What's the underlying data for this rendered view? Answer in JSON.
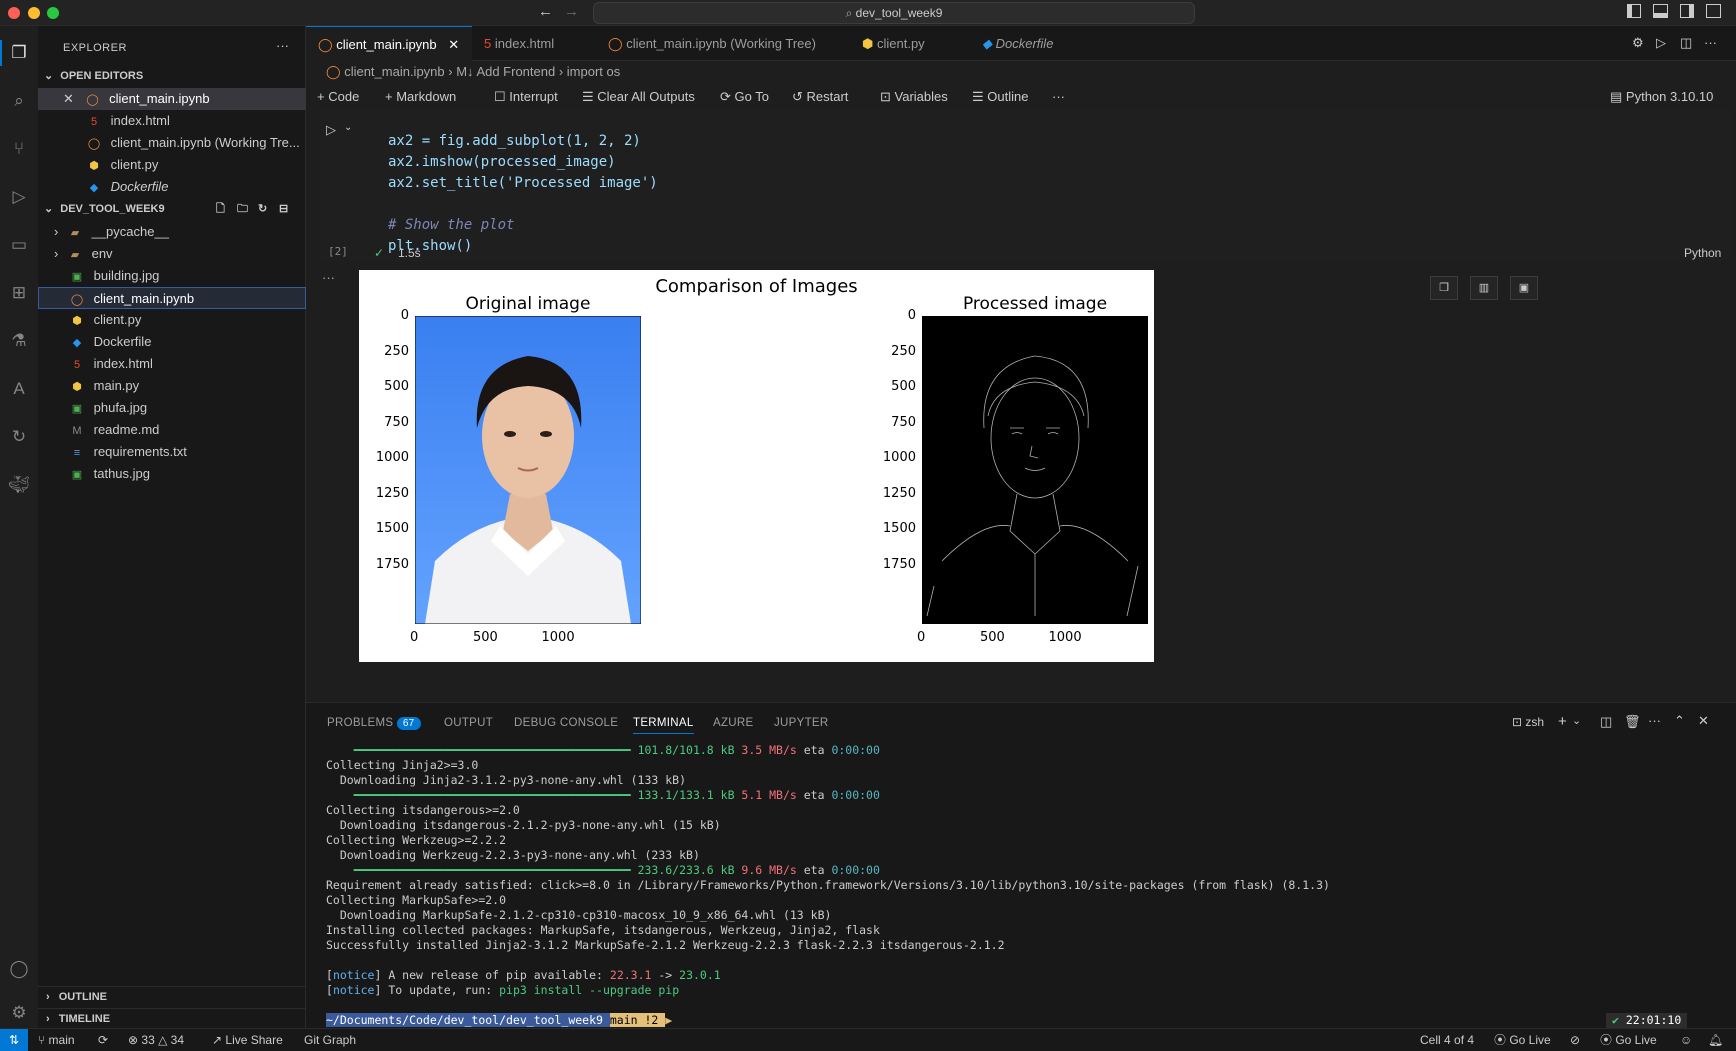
{
  "window": {
    "title": "dev_tool_week9"
  },
  "explorer": {
    "title": "EXPLORER",
    "open_editors_label": "OPEN EDITORS",
    "open_editors": [
      {
        "name": "client_main.ipynb",
        "icon": "notebook-icon"
      },
      {
        "name": "index.html",
        "icon": "html-icon"
      },
      {
        "name": "client_main.ipynb (Working Tre...",
        "icon": "notebook-icon"
      },
      {
        "name": "client.py",
        "icon": "python-icon"
      },
      {
        "name": "Dockerfile",
        "icon": "docker-icon"
      }
    ],
    "folder_label": "DEV_TOOL_WEEK9",
    "files": [
      {
        "name": "__pycache__",
        "icon": "folder-icon"
      },
      {
        "name": "env",
        "icon": "folder-icon"
      },
      {
        "name": "building.jpg",
        "icon": "image-icon"
      },
      {
        "name": "client_main.ipynb",
        "icon": "notebook-icon"
      },
      {
        "name": "client.py",
        "icon": "python-icon"
      },
      {
        "name": "Dockerfile",
        "icon": "docker-icon"
      },
      {
        "name": "index.html",
        "icon": "html-icon"
      },
      {
        "name": "main.py",
        "icon": "python-icon"
      },
      {
        "name": "phufa.jpg",
        "icon": "image-icon"
      },
      {
        "name": "readme.md",
        "icon": "markdown-icon"
      },
      {
        "name": "requirements.txt",
        "icon": "text-icon"
      },
      {
        "name": "tathus.jpg",
        "icon": "image-icon"
      }
    ],
    "outline_label": "OUTLINE",
    "timeline_label": "TIMELINE"
  },
  "tabs": [
    {
      "label": "client_main.ipynb"
    },
    {
      "label": "index.html"
    },
    {
      "label": "client_main.ipynb (Working Tree)"
    },
    {
      "label": "client.py"
    },
    {
      "label": "Dockerfile"
    }
  ],
  "breadcrumb": {
    "file": "client_main.ipynb",
    "section": "M↓ Add Frontend",
    "symbol": "import os"
  },
  "notebook_toolbar": {
    "code": "Code",
    "markdown": "Markdown",
    "interrupt": "Interrupt",
    "clear": "Clear All Outputs",
    "goto": "Go To",
    "restart": "Restart",
    "variables": "Variables",
    "outline": "Outline",
    "more": "···",
    "kernel": "Python 3.10.10"
  },
  "cell": {
    "exec_count": "[2]",
    "duration": "1.5s",
    "language": "Python",
    "code": {
      "line1": "ax2 = fig.add_subplot(1, 2, 2)",
      "line2": "ax2.imshow(processed_image)",
      "line3": "ax2.set_title('Processed image')",
      "line5": "# Show the plot",
      "line6": "plt.show()"
    }
  },
  "figure": {
    "title": "Comparison of Images",
    "left_title": "Original image",
    "right_title": "Processed image",
    "y_ticks": [
      "0",
      "250",
      "500",
      "750",
      "1000",
      "1250",
      "1500",
      "1750"
    ],
    "x_ticks": [
      "0",
      "500",
      "1000"
    ]
  },
  "panel": {
    "tabs": [
      "PROBLEMS",
      "OUTPUT",
      "DEBUG CONSOLE",
      "TERMINAL",
      "AZURE",
      "JUPYTER"
    ],
    "problems_count": "67",
    "shell": "zsh"
  },
  "terminal": {
    "lines": [
      {
        "parts": [
          {
            "t": "    ━━━━━━━━━━━━━━━━━━━━━━━━━━━━━━━━━━━━━━━━ ",
            "c": "g"
          },
          {
            "t": "101.8/101.8 kB",
            "c": "g"
          },
          {
            "t": " 3.5 MB/s",
            "c": "r"
          },
          {
            "t": " eta ",
            "c": ""
          },
          {
            "t": "0:00:00",
            "c": "c"
          }
        ]
      },
      {
        "parts": [
          {
            "t": "Collecting Jinja2>=3.0",
            "c": ""
          }
        ]
      },
      {
        "parts": [
          {
            "t": "  Downloading Jinja2-3.1.2-py3-none-any.whl (133 kB)",
            "c": ""
          }
        ]
      },
      {
        "parts": [
          {
            "t": "    ━━━━━━━━━━━━━━━━━━━━━━━━━━━━━━━━━━━━━━━━ ",
            "c": "g"
          },
          {
            "t": "133.1/133.1 kB",
            "c": "g"
          },
          {
            "t": " 5.1 MB/s",
            "c": "r"
          },
          {
            "t": " eta ",
            "c": ""
          },
          {
            "t": "0:00:00",
            "c": "c"
          }
        ]
      },
      {
        "parts": [
          {
            "t": "Collecting itsdangerous>=2.0",
            "c": ""
          }
        ]
      },
      {
        "parts": [
          {
            "t": "  Downloading itsdangerous-2.1.2-py3-none-any.whl (15 kB)",
            "c": ""
          }
        ]
      },
      {
        "parts": [
          {
            "t": "Collecting Werkzeug>=2.2.2",
            "c": ""
          }
        ]
      },
      {
        "parts": [
          {
            "t": "  Downloading Werkzeug-2.2.3-py3-none-any.whl (233 kB)",
            "c": ""
          }
        ]
      },
      {
        "parts": [
          {
            "t": "    ━━━━━━━━━━━━━━━━━━━━━━━━━━━━━━━━━━━━━━━━ ",
            "c": "g"
          },
          {
            "t": "233.6/233.6 kB",
            "c": "g"
          },
          {
            "t": " 9.6 MB/s",
            "c": "r"
          },
          {
            "t": " eta ",
            "c": ""
          },
          {
            "t": "0:00:00",
            "c": "c"
          }
        ]
      },
      {
        "parts": [
          {
            "t": "Requirement already satisfied: click>=8.0 in /Library/Frameworks/Python.framework/Versions/3.10/lib/python3.10/site-packages (from flask) (8.1.3)",
            "c": ""
          }
        ]
      },
      {
        "parts": [
          {
            "t": "Collecting MarkupSafe>=2.0",
            "c": ""
          }
        ]
      },
      {
        "parts": [
          {
            "t": "  Downloading MarkupSafe-2.1.2-cp310-cp310-macosx_10_9_x86_64.whl (13 kB)",
            "c": ""
          }
        ]
      },
      {
        "parts": [
          {
            "t": "Installing collected packages: MarkupSafe, itsdangerous, Werkzeug, Jinja2, flask",
            "c": ""
          }
        ]
      },
      {
        "parts": [
          {
            "t": "Successfully installed Jinja2-3.1.2 MarkupSafe-2.1.2 Werkzeug-2.2.3 flask-2.2.3 itsdangerous-2.1.2",
            "c": ""
          }
        ]
      },
      {
        "parts": [
          {
            "t": " ",
            "c": ""
          }
        ]
      },
      {
        "parts": [
          {
            "t": "[",
            "c": ""
          },
          {
            "t": "notice",
            "c": "b"
          },
          {
            "t": "] A new release of pip available: ",
            "c": ""
          },
          {
            "t": "22.3.1",
            "c": "r"
          },
          {
            "t": " -> ",
            "c": ""
          },
          {
            "t": "23.0.1",
            "c": "g"
          }
        ]
      },
      {
        "parts": [
          {
            "t": "[",
            "c": ""
          },
          {
            "t": "notice",
            "c": "b"
          },
          {
            "t": "] To update, run: ",
            "c": ""
          },
          {
            "t": "pip3 install --upgrade pip",
            "c": "g"
          }
        ]
      }
    ],
    "prompt_path": " ~/Documents/Code/dev_tool/dev_tool_week9 ",
    "prompt_git": " main !2 ",
    "clock": "22:01:10"
  },
  "status": {
    "branch": "main",
    "errors": "33",
    "warnings": "34",
    "live_share": "Live Share",
    "git_graph": "Git Graph",
    "cell": "Cell 4 of 4",
    "go_live_1": "Go Live",
    "go_live_2": "Go Live"
  },
  "colors": {
    "accent": "#0078d4",
    "photo_bg": "#3b82f6"
  }
}
